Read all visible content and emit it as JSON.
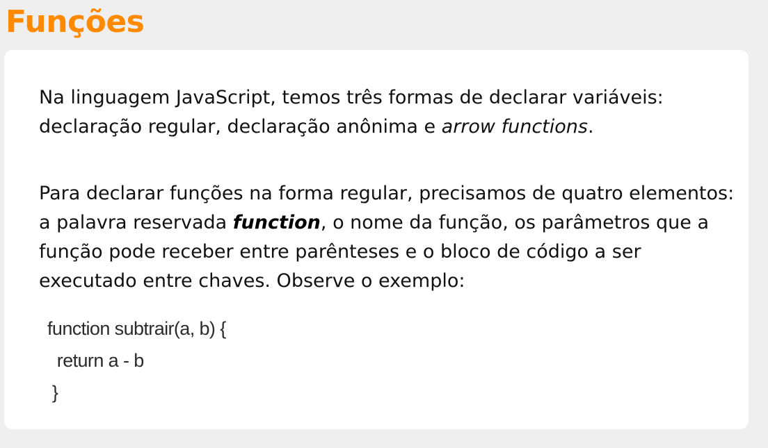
{
  "title": "Funções",
  "paragraph1": {
    "text_before": "Na linguagem JavaScript, temos três formas de declarar variáveis: declaração regular, declaração anônima e ",
    "italic": "arrow functions",
    "text_after": "."
  },
  "paragraph2": {
    "text_before": "Para declarar funções na forma regular, precisamos de quatro elementos: a palavra reservada ",
    "keyword": "function",
    "text_after": ", o nome da função, os parâmetros que a função pode receber entre parênteses e o bloco de código a ser executado entre chaves. Observe o exemplo:"
  },
  "code": {
    "lines": [
      "function subtrair(a, b) {",
      "  return a - b",
      " }"
    ]
  },
  "colors": {
    "title": "#ff8a00",
    "background": "#efefef",
    "card": "#ffffff"
  }
}
